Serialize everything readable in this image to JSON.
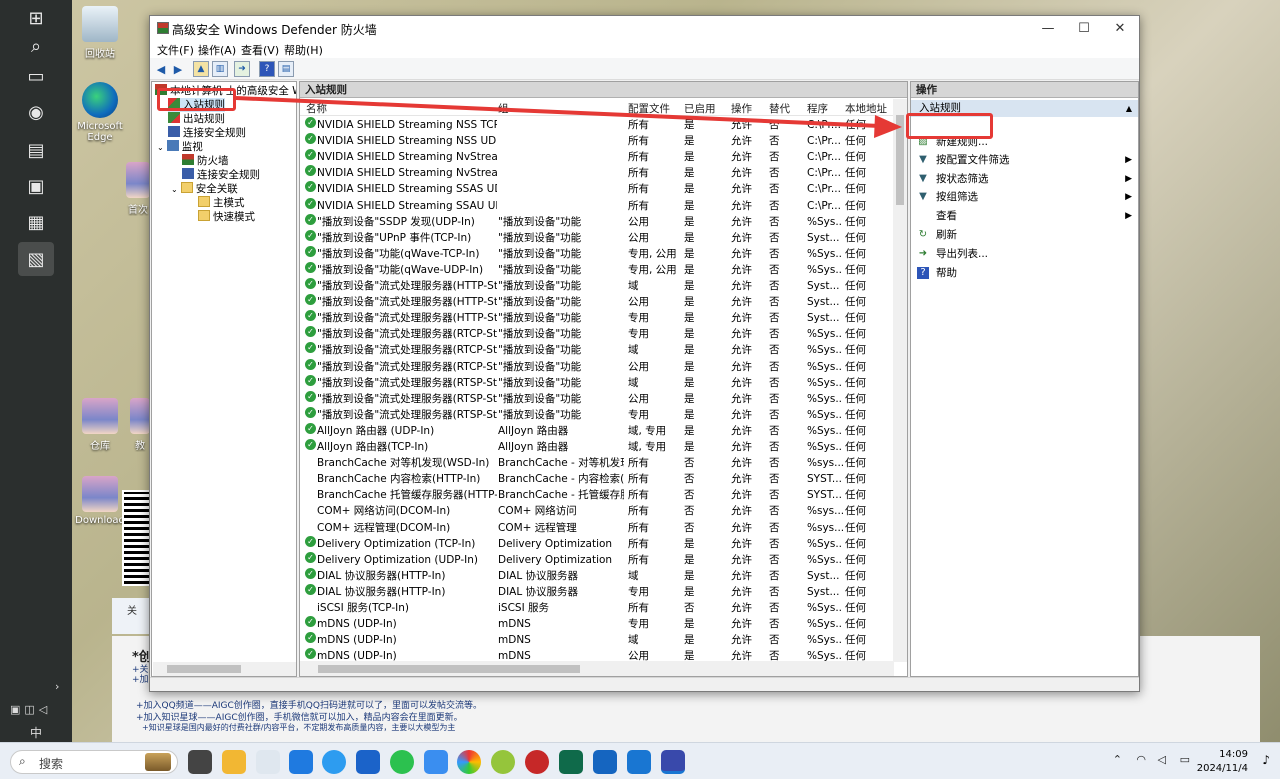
{
  "desktop": {
    "icons": [
      {
        "label": "回收站"
      },
      {
        "label": "Microsoft Edge"
      },
      {
        "label": "首次"
      },
      {
        "label": "仓库"
      },
      {
        "label": "Download"
      },
      {
        "label": "教"
      }
    ],
    "doc_lines": [
      "*创",
      "+关",
      "+加",
      "+加入QQ频道——AIGC创作圈，直接手机QQ扫码进就可以了，里面可以发帖交流等。",
      "+加入知识星球——AIGC创作圈，手机微信就可以加入，精品内容会在里面更新。",
      "+知识星球是国内最好的付费社群/内容平台，不定期发布高质量内容，主要以大模型为主"
    ],
    "side_fragment": "关",
    "input_indicator": "中"
  },
  "window": {
    "title": "高级安全 Windows Defender 防火墙",
    "controls": {
      "minimize": "—",
      "maximize": "☐",
      "close": "✕"
    },
    "menu": [
      "文件(F)",
      "操作(A)",
      "查看(V)",
      "帮助(H)"
    ]
  },
  "tree": {
    "items": [
      {
        "label": "本地计算机 上的高级安全 Windows Defender 防火墙"
      },
      {
        "label": "入站规则"
      },
      {
        "label": "出站规则"
      },
      {
        "label": "连接安全规则"
      },
      {
        "label": "监视"
      },
      {
        "label": "防火墙"
      },
      {
        "label": "连接安全规则"
      },
      {
        "label": "安全关联"
      },
      {
        "label": "主模式"
      },
      {
        "label": "快速模式"
      }
    ]
  },
  "center": {
    "header": "入站规则",
    "columns": [
      "名称",
      "组",
      "配置文件",
      "已启用",
      "操作",
      "替代",
      "程序",
      "本地地址"
    ],
    "rows": [
      {
        "name": "NVIDIA SHIELD Streaming NSS TCP Exc...",
        "group": "",
        "profile": "所有",
        "enabled": "是",
        "action": "允许",
        "override": "否",
        "program": "C:\\Pr...",
        "local": "任何"
      },
      {
        "name": "NVIDIA SHIELD Streaming NSS UDP Ex...",
        "group": "",
        "profile": "所有",
        "enabled": "是",
        "action": "允许",
        "override": "否",
        "program": "C:\\Pr...",
        "local": "任何"
      },
      {
        "name": "NVIDIA SHIELD Streaming NvStreamer ...",
        "group": "",
        "profile": "所有",
        "enabled": "是",
        "action": "允许",
        "override": "否",
        "program": "C:\\Pr...",
        "local": "任何"
      },
      {
        "name": "NVIDIA SHIELD Streaming NvStreamer ...",
        "group": "",
        "profile": "所有",
        "enabled": "是",
        "action": "允许",
        "override": "否",
        "program": "C:\\Pr...",
        "local": "任何"
      },
      {
        "name": "NVIDIA SHIELD Streaming SSAS UDP E...",
        "group": "",
        "profile": "所有",
        "enabled": "是",
        "action": "允许",
        "override": "否",
        "program": "C:\\Pr...",
        "local": "任何"
      },
      {
        "name": "NVIDIA SHIELD Streaming SSAU UDP E...",
        "group": "",
        "profile": "所有",
        "enabled": "是",
        "action": "允许",
        "override": "否",
        "program": "C:\\Pr...",
        "local": "任何"
      },
      {
        "name": "\"播放到设备\"SSDP 发现(UDP-In)",
        "group": "\"播放到设备\"功能",
        "profile": "公用",
        "enabled": "是",
        "action": "允许",
        "override": "否",
        "program": "%Sys...",
        "local": "任何"
      },
      {
        "name": "\"播放到设备\"UPnP 事件(TCP-In)",
        "group": "\"播放到设备\"功能",
        "profile": "公用",
        "enabled": "是",
        "action": "允许",
        "override": "否",
        "program": "Syst...",
        "local": "任何"
      },
      {
        "name": "\"播放到设备\"功能(qWave-TCP-In)",
        "group": "\"播放到设备\"功能",
        "profile": "专用, 公用",
        "enabled": "是",
        "action": "允许",
        "override": "否",
        "program": "%Sys...",
        "local": "任何"
      },
      {
        "name": "\"播放到设备\"功能(qWave-UDP-In)",
        "group": "\"播放到设备\"功能",
        "profile": "专用, 公用",
        "enabled": "是",
        "action": "允许",
        "override": "否",
        "program": "%Sys...",
        "local": "任何"
      },
      {
        "name": "\"播放到设备\"流式处理服务器(HTTP-Stre...",
        "group": "\"播放到设备\"功能",
        "profile": "域",
        "enabled": "是",
        "action": "允许",
        "override": "否",
        "program": "Syst...",
        "local": "任何"
      },
      {
        "name": "\"播放到设备\"流式处理服务器(HTTP-Stre...",
        "group": "\"播放到设备\"功能",
        "profile": "公用",
        "enabled": "是",
        "action": "允许",
        "override": "否",
        "program": "Syst...",
        "local": "任何"
      },
      {
        "name": "\"播放到设备\"流式处理服务器(HTTP-Stre...",
        "group": "\"播放到设备\"功能",
        "profile": "专用",
        "enabled": "是",
        "action": "允许",
        "override": "否",
        "program": "Syst...",
        "local": "任何"
      },
      {
        "name": "\"播放到设备\"流式处理服务器(RTCP-Stre...",
        "group": "\"播放到设备\"功能",
        "profile": "专用",
        "enabled": "是",
        "action": "允许",
        "override": "否",
        "program": "%Sys...",
        "local": "任何"
      },
      {
        "name": "\"播放到设备\"流式处理服务器(RTCP-Stre...",
        "group": "\"播放到设备\"功能",
        "profile": "域",
        "enabled": "是",
        "action": "允许",
        "override": "否",
        "program": "%Sys...",
        "local": "任何"
      },
      {
        "name": "\"播放到设备\"流式处理服务器(RTCP-Stre...",
        "group": "\"播放到设备\"功能",
        "profile": "公用",
        "enabled": "是",
        "action": "允许",
        "override": "否",
        "program": "%Sys...",
        "local": "任何"
      },
      {
        "name": "\"播放到设备\"流式处理服务器(RTSP-Stre...",
        "group": "\"播放到设备\"功能",
        "profile": "域",
        "enabled": "是",
        "action": "允许",
        "override": "否",
        "program": "%Sys...",
        "local": "任何"
      },
      {
        "name": "\"播放到设备\"流式处理服务器(RTSP-Stre...",
        "group": "\"播放到设备\"功能",
        "profile": "公用",
        "enabled": "是",
        "action": "允许",
        "override": "否",
        "program": "%Sys...",
        "local": "任何"
      },
      {
        "name": "\"播放到设备\"流式处理服务器(RTSP-Stre...",
        "group": "\"播放到设备\"功能",
        "profile": "专用",
        "enabled": "是",
        "action": "允许",
        "override": "否",
        "program": "%Sys...",
        "local": "任何"
      },
      {
        "name": "AllJoyn 路由器 (UDP-In)",
        "group": "AllJoyn 路由器",
        "profile": "域, 专用",
        "enabled": "是",
        "action": "允许",
        "override": "否",
        "program": "%Sys...",
        "local": "任何"
      },
      {
        "name": "AllJoyn 路由器(TCP-In)",
        "group": "AllJoyn 路由器",
        "profile": "域, 专用",
        "enabled": "是",
        "action": "允许",
        "override": "否",
        "program": "%Sys...",
        "local": "任何"
      },
      {
        "name": "BranchCache 对等机发现(WSD-In)",
        "group": "BranchCache - 对等机发现(...",
        "profile": "所有",
        "enabled": "否",
        "action": "允许",
        "override": "否",
        "program": "%sys...",
        "local": "任何"
      },
      {
        "name": "BranchCache 内容检索(HTTP-In)",
        "group": "BranchCache - 内容检索(使...",
        "profile": "所有",
        "enabled": "否",
        "action": "允许",
        "override": "否",
        "program": "SYST...",
        "local": "任何"
      },
      {
        "name": "BranchCache 托管缓存服务器(HTTP-In)",
        "group": "BranchCache - 托管缓存服...",
        "profile": "所有",
        "enabled": "否",
        "action": "允许",
        "override": "否",
        "program": "SYST...",
        "local": "任何"
      },
      {
        "name": "COM+ 网络访问(DCOM-In)",
        "group": "COM+ 网络访问",
        "profile": "所有",
        "enabled": "否",
        "action": "允许",
        "override": "否",
        "program": "%sys...",
        "local": "任何"
      },
      {
        "name": "COM+ 远程管理(DCOM-In)",
        "group": "COM+ 远程管理",
        "profile": "所有",
        "enabled": "否",
        "action": "允许",
        "override": "否",
        "program": "%sys...",
        "local": "任何"
      },
      {
        "name": "Delivery Optimization (TCP-In)",
        "group": "Delivery Optimization",
        "profile": "所有",
        "enabled": "是",
        "action": "允许",
        "override": "否",
        "program": "%Sys...",
        "local": "任何"
      },
      {
        "name": "Delivery Optimization (UDP-In)",
        "group": "Delivery Optimization",
        "profile": "所有",
        "enabled": "是",
        "action": "允许",
        "override": "否",
        "program": "%Sys...",
        "local": "任何"
      },
      {
        "name": "DIAL 协议服务器(HTTP-In)",
        "group": "DIAL 协议服务器",
        "profile": "域",
        "enabled": "是",
        "action": "允许",
        "override": "否",
        "program": "Syst...",
        "local": "任何"
      },
      {
        "name": "DIAL 协议服务器(HTTP-In)",
        "group": "DIAL 协议服务器",
        "profile": "专用",
        "enabled": "是",
        "action": "允许",
        "override": "否",
        "program": "Syst...",
        "local": "任何"
      },
      {
        "name": "iSCSI 服务(TCP-In)",
        "group": "iSCSI 服务",
        "profile": "所有",
        "enabled": "否",
        "action": "允许",
        "override": "否",
        "program": "%Sys...",
        "local": "任何"
      },
      {
        "name": "mDNS (UDP-In)",
        "group": "mDNS",
        "profile": "专用",
        "enabled": "是",
        "action": "允许",
        "override": "否",
        "program": "%Sys...",
        "local": "任何"
      },
      {
        "name": "mDNS (UDP-In)",
        "group": "mDNS",
        "profile": "域",
        "enabled": "是",
        "action": "允许",
        "override": "否",
        "program": "%Sys...",
        "local": "任何"
      },
      {
        "name": "mDNS (UDP-In)",
        "group": "mDNS",
        "profile": "公用",
        "enabled": "是",
        "action": "允许",
        "override": "否",
        "program": "%Sys...",
        "local": "任何"
      }
    ]
  },
  "actions": {
    "header": "操作",
    "section": "入站规则",
    "items": [
      {
        "label": "新建规则...",
        "icon": "new-rule-icon",
        "has_submenu": false
      },
      {
        "label": "按配置文件筛选",
        "icon": "filter-icon",
        "has_submenu": true
      },
      {
        "label": "按状态筛选",
        "icon": "filter-icon",
        "has_submenu": true
      },
      {
        "label": "按组筛选",
        "icon": "filter-icon",
        "has_submenu": true
      },
      {
        "label": "查看",
        "icon": "",
        "has_submenu": true
      },
      {
        "label": "刷新",
        "icon": "refresh-icon",
        "has_submenu": false
      },
      {
        "label": "导出列表...",
        "icon": "export-icon",
        "has_submenu": false
      },
      {
        "label": "帮助",
        "icon": "help-icon",
        "has_submenu": false
      }
    ]
  },
  "taskbar": {
    "search_placeholder": "搜索",
    "time": "14:09",
    "date": "2024/11/4"
  },
  "colors": {
    "annotation_red": "#e53935",
    "enabled_green": "#2e9e3e",
    "selection_blue": "#cce4f7"
  }
}
